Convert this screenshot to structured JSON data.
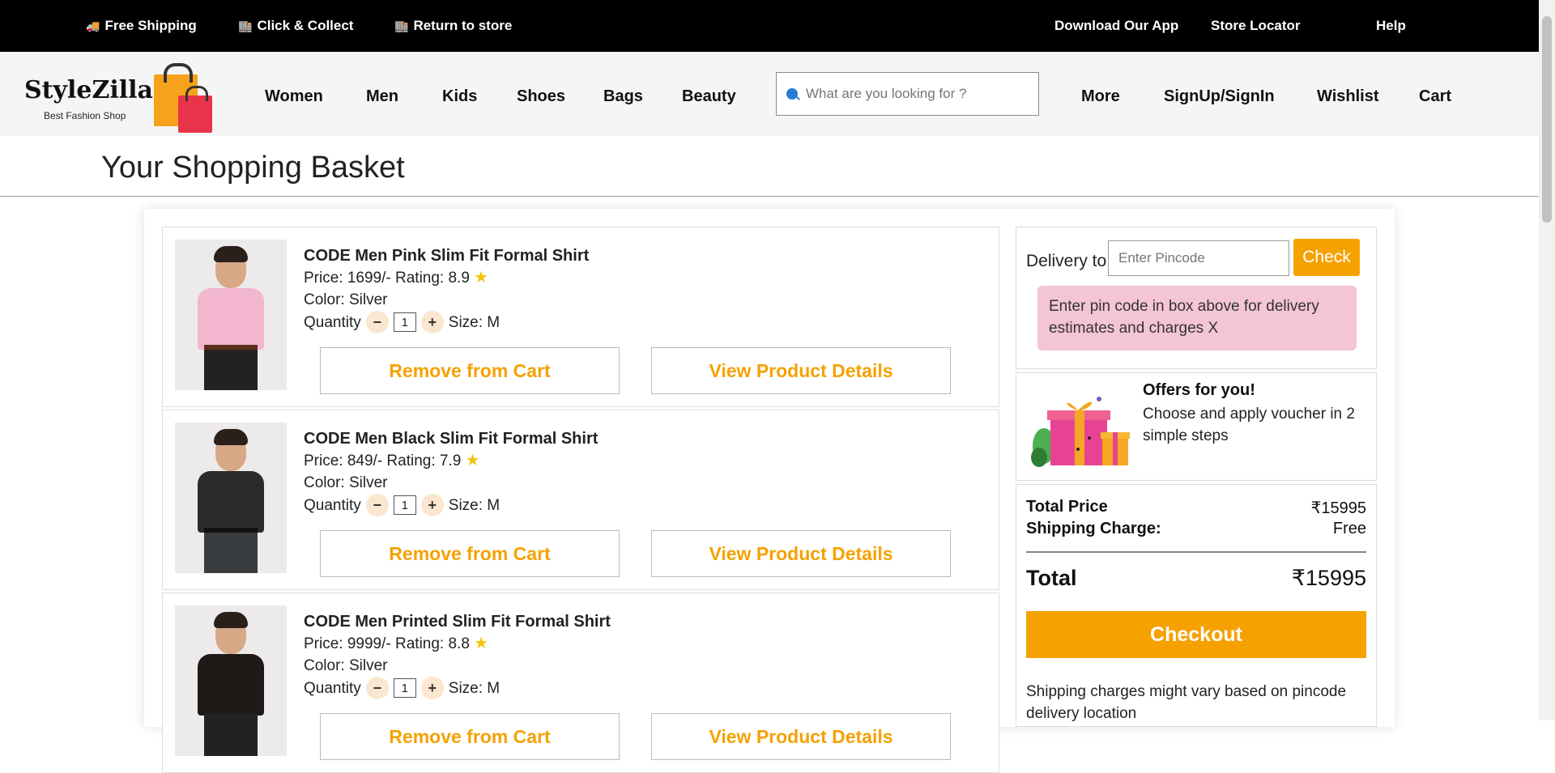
{
  "topbar": {
    "left": [
      {
        "icon": "truck-icon",
        "label": "Free Shipping"
      },
      {
        "icon": "store-icon",
        "label": "Click & Collect"
      },
      {
        "icon": "return-icon",
        "label": "Return to store"
      }
    ],
    "right": [
      "Download Our App",
      "Store Locator",
      "Help"
    ]
  },
  "header": {
    "brand": "StyleZilla",
    "tagline": "Best Fashion Shop",
    "nav": [
      "Women",
      "Men",
      "Kids",
      "Shoes",
      "Bags",
      "Beauty"
    ],
    "search_placeholder": "What are you looking for ?",
    "right_nav": [
      "More",
      "SignUp/SignIn",
      "Wishlist",
      "Cart"
    ]
  },
  "page_title": "Your Shopping Basket",
  "items": [
    {
      "name": "CODE Men Pink Slim Fit Formal Shirt",
      "price": "Price: 1699/- Rating: 8.9",
      "color": "Color: Silver",
      "quantity_label": "Quantity",
      "quantity": "1",
      "size": "Size: M",
      "shirt_color": "#f2b6cf"
    },
    {
      "name": "CODE Men Black Slim Fit Formal Shirt",
      "price": "Price: 849/- Rating: 7.9",
      "color": "Color: Silver",
      "quantity_label": "Quantity",
      "quantity": "1",
      "size": "Size: M",
      "shirt_color": "#2b2b2b"
    },
    {
      "name": "CODE Men Printed Slim Fit Formal Shirt",
      "price": "Price: 9999/- Rating: 8.8",
      "color": "Color: Silver",
      "quantity_label": "Quantity",
      "quantity": "1",
      "size": "Size: M",
      "shirt_color": "#1d1a18"
    }
  ],
  "item_buttons": {
    "remove": "Remove from Cart",
    "details": "View Product Details"
  },
  "delivery": {
    "label": "Delivery to",
    "placeholder": "Enter Pincode",
    "check": "Check",
    "note": "Enter pin code in box above for delivery estimates and charges X"
  },
  "offers": {
    "title": "Offers for you!",
    "desc": "Choose and apply voucher in 2 simple steps"
  },
  "totals": {
    "total_price_label": "Total Price",
    "total_price": "₹15995",
    "shipping_label": "Shipping Charge:",
    "shipping": "Free",
    "total_label": "Total",
    "total": "₹15995",
    "checkout": "Checkout",
    "shipping_note": "Shipping charges might vary based on pincode delivery location"
  },
  "colors": {
    "accent": "#f5a100",
    "note_bg": "#f4c5d2",
    "topbar": "#000000",
    "header_bg": "#f4f6f6"
  }
}
